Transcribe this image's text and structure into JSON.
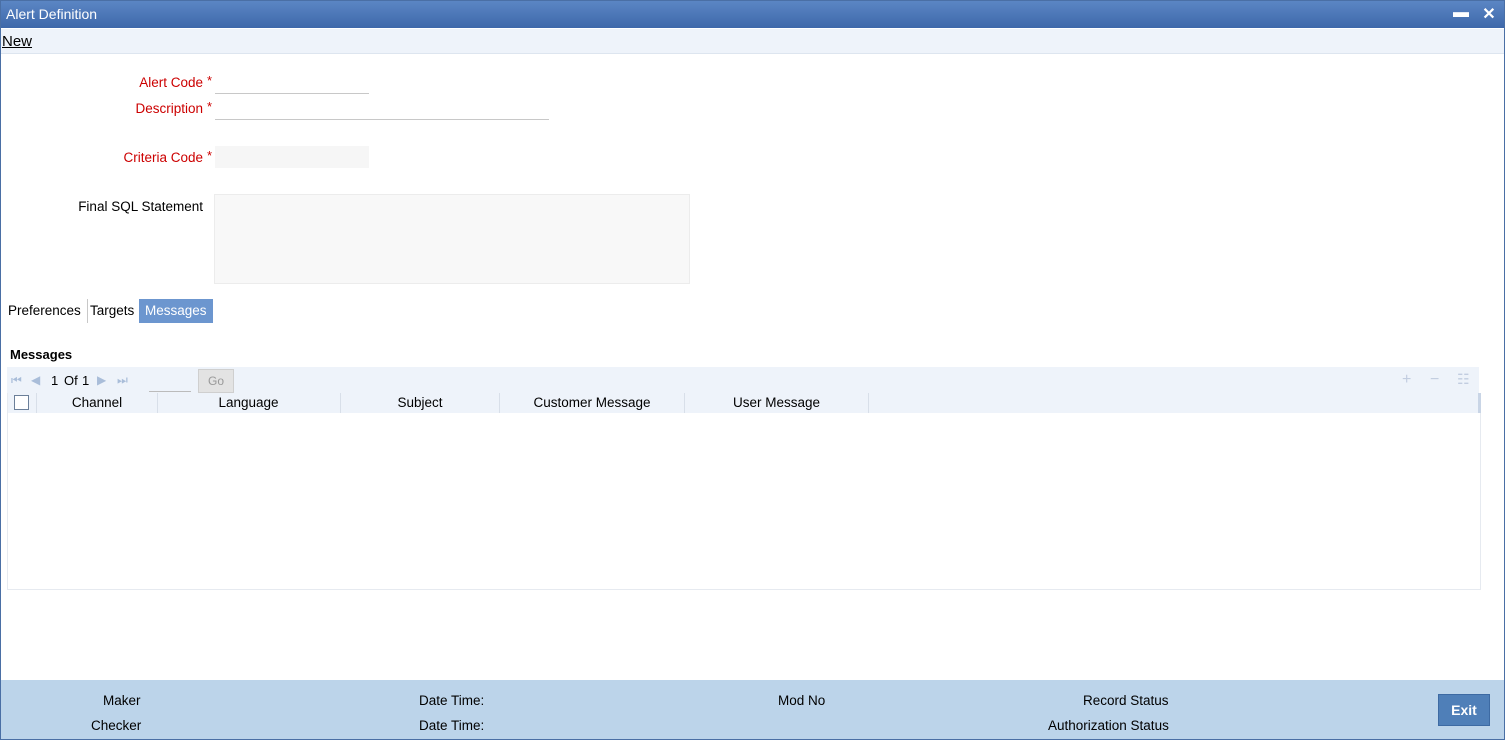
{
  "window": {
    "title": "Alert Definition",
    "minimize_glyph": "▬",
    "close_glyph": "✕"
  },
  "menu": {
    "new_label": "New"
  },
  "form": {
    "alert_code_label": "Alert Code",
    "description_label": "Description",
    "criteria_code_label": "Criteria Code",
    "final_sql_label": "Final SQL Statement",
    "required_mark": "*"
  },
  "tabs": [
    {
      "label": "Preferences",
      "active": false
    },
    {
      "label": "Targets",
      "active": false
    },
    {
      "label": "Messages",
      "active": true
    }
  ],
  "messages": {
    "section_title": "Messages",
    "pagination": {
      "current": "1",
      "of_label": "Of",
      "total": "1",
      "go_label": "Go"
    },
    "columns": [
      "Channel",
      "Language",
      "Subject",
      "Customer Message",
      "User Message"
    ]
  },
  "footer": {
    "maker_label": "Maker",
    "checker_label": "Checker",
    "date_time_label_1": "Date Time:",
    "date_time_label_2": "Date Time:",
    "mod_no_label": "Mod No",
    "record_status_label": "Record Status",
    "authorization_status_label": "Authorization Status",
    "exit_label": "Exit"
  },
  "icons": {
    "first": "first-page-icon",
    "prev": "prev-page-icon",
    "next": "next-page-icon",
    "last": "last-page-icon",
    "add": "add-row-icon",
    "delete": "delete-row-icon",
    "view": "single-view-icon"
  },
  "colors": {
    "title_bar": "#4a76b6",
    "active_tab": "#6c96cf",
    "footer": "#bcd4ea",
    "required": "#cc0000"
  }
}
